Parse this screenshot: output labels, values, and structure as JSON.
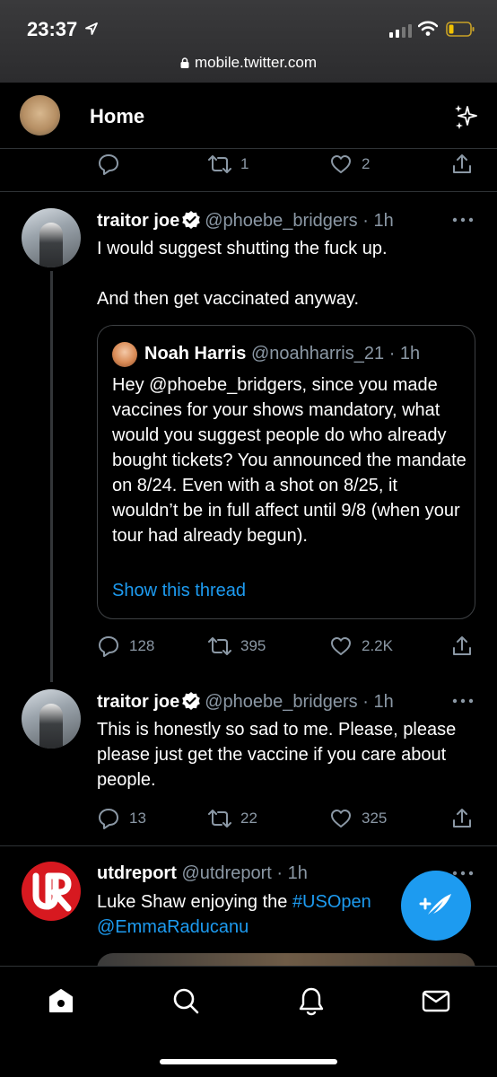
{
  "status_bar": {
    "time": "23:37",
    "url": "mobile.twitter.com",
    "icons": [
      "location-arrow-icon",
      "signal-icon",
      "wifi-icon",
      "battery-icon",
      "lock-icon"
    ]
  },
  "header": {
    "title": "Home",
    "icons": [
      "avatar",
      "sparkle-icon"
    ]
  },
  "top_actions": {
    "reply_count": "",
    "retweet_count": "1",
    "like_count": "2"
  },
  "tweets": [
    {
      "name": "traitor joe",
      "verified": true,
      "handle": "@phoebe_bridgers",
      "time": "· 1h",
      "text_line1": "I would suggest shutting the fuck up.",
      "text_line2": "And then get vaccinated anyway.",
      "quote": {
        "name": "Noah Harris",
        "handle": "@noahharris_21",
        "time": "· 1h",
        "text": "Hey @phoebe_bridgers, since you made vaccines for your shows mandatory, what would you suggest people do who already bought tickets? You announced the mandate on 8/24. Even with a shot on 8/25, it wouldn’t be in full affect until 9/8 (when your tour had already begun).",
        "show_thread": "Show this thread"
      },
      "reply_count": "128",
      "retweet_count": "395",
      "like_count": "2.2K"
    },
    {
      "name": "traitor joe",
      "verified": true,
      "handle": "@phoebe_bridgers",
      "time": "· 1h",
      "text": "This is honestly so sad to me. Please, please please just get the vaccine if you care about people.",
      "reply_count": "13",
      "retweet_count": "22",
      "like_count": "325"
    },
    {
      "name": "utdreport",
      "handle": "@utdreport",
      "time": "· 1h",
      "text_prefix": "Luke Shaw enjoying the ",
      "hashtag": "#USOpen",
      "mention": "@EmmaRaducanu"
    }
  ],
  "bottom_nav": [
    "home-icon",
    "search-icon",
    "notifications-bell-icon",
    "messages-envelope-icon"
  ],
  "colors": {
    "background": "#000000",
    "accent": "#1d9bf0",
    "muted_text": "#8b98a5",
    "divider": "#2f3336"
  }
}
